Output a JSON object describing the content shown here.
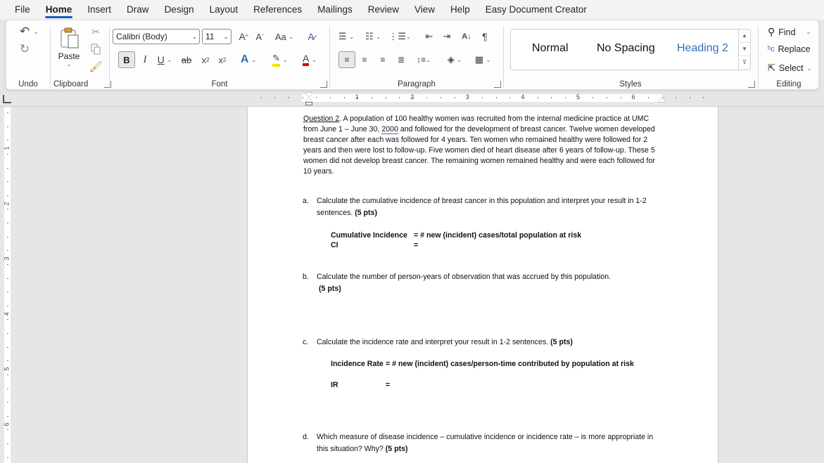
{
  "menu": {
    "tabs": [
      "File",
      "Home",
      "Insert",
      "Draw",
      "Design",
      "Layout",
      "References",
      "Mailings",
      "Review",
      "View",
      "Help",
      "Easy Document Creator"
    ],
    "active": "Home"
  },
  "ribbon": {
    "undo": {
      "label": "Undo"
    },
    "clipboard": {
      "label": "Clipboard",
      "paste": "Paste"
    },
    "font": {
      "label": "Font",
      "name": "Calibri (Body)",
      "size": "11",
      "bold": "B",
      "italic": "I",
      "underline": "U",
      "strike": "ab",
      "sub": "x",
      "sup": "x",
      "change_case": "Aa",
      "grow": "A",
      "shrink": "A",
      "text_effects": "A",
      "font_color": "A"
    },
    "paragraph": {
      "label": "Paragraph"
    },
    "styles": {
      "label": "Styles",
      "items": [
        "Normal",
        "No Spacing",
        "Heading 2"
      ]
    },
    "editing": {
      "label": "Editing",
      "find": "Find",
      "replace": "Replace",
      "select": "Select"
    }
  },
  "ruler": {
    "h_numbers": [
      "1",
      "2",
      "3",
      "4",
      "5",
      "6"
    ],
    "v_numbers": [
      "1",
      "2",
      "3",
      "4",
      "5",
      "6"
    ]
  },
  "document": {
    "q_label": "Question 2",
    "q_text_1": ".  A population of 100 healthy women was recruited from the internal medicine practice at UMC from June 1 – June 30, ",
    "q_year": "2000",
    "q_text_2": " and followed for the development of breast cancer.  Twelve women developed breast cancer after each was followed for 4 years.  Ten women who remained healthy were followed for 2 years and then were lost to follow-up.  Five women died of heart disease after 6 years of follow-up.  These 5 women did not develop breast cancer. The remaining women remained healthy and were each followed for 10 years.",
    "a": {
      "letter": "a.",
      "text": "Calculate the cumulative incidence of breast cancer in this population and interpret your result in 1-2 sentences. ",
      "pts": "(5 pts)"
    },
    "ci_formula": {
      "label": "Cumulative Incidence",
      "eq": "= # new (incident) cases/total population at risk",
      "abbr": "CI",
      "eq2": "="
    },
    "b": {
      "letter": "b.",
      "text": "Calculate the number of person-years of observation that was accrued by this population.",
      "pts": "(5 pts)"
    },
    "c": {
      "letter": "c.",
      "text": "Calculate the incidence rate and interpret your result in 1-2 sentences. ",
      "pts": "(5 pts)"
    },
    "ir_formula": {
      "label": "Incidence Rate",
      "eq": "= # new (incident) cases/person-time contributed by population at risk",
      "abbr": "IR",
      "eq2": "="
    },
    "d": {
      "letter": "d.",
      "text": "Which measure of disease incidence – cumulative incidence or incidence rate – is more appropriate in this situation?  Why? ",
      "pts": "(5 pts)"
    }
  }
}
